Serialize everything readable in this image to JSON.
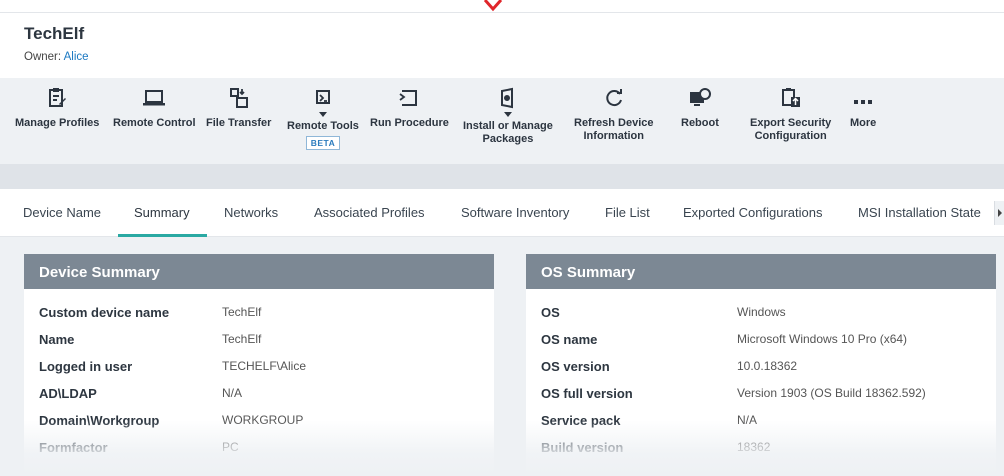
{
  "device": {
    "name": "TechElf",
    "owner_label": "Owner:",
    "owner_name": "Alice"
  },
  "toolbar": [
    {
      "label": "Manage Profiles",
      "icon": "manage-profiles-icon"
    },
    {
      "label": "Remote Control",
      "icon": "laptop-icon"
    },
    {
      "label": "File Transfer",
      "icon": "file-transfer-icon"
    },
    {
      "label": "Remote Tools",
      "icon": "remote-tools-icon",
      "badge": "BETA"
    },
    {
      "label": "Run Procedure",
      "icon": "run-procedure-icon"
    },
    {
      "label": "Install or Manage Packages",
      "line1": "Install or Manage",
      "line2": "Packages",
      "icon": "package-icon"
    },
    {
      "label": "Refresh Device Information",
      "line1": "Refresh Device",
      "line2": "Information",
      "icon": "refresh-icon"
    },
    {
      "label": "Reboot",
      "icon": "reboot-icon"
    },
    {
      "label": "Export Security Configuration",
      "line1": "Export Security",
      "line2": "Configuration",
      "icon": "export-icon"
    },
    {
      "label": "More",
      "icon": "more-icon"
    }
  ],
  "tabs": [
    "Device Name",
    "Summary",
    "Networks",
    "Associated Profiles",
    "Software Inventory",
    "File List",
    "Exported Configurations",
    "MSI Installation State"
  ],
  "active_tab": "Summary",
  "device_summary": {
    "title": "Device Summary",
    "rows": [
      {
        "key": "Custom device name",
        "value": "TechElf"
      },
      {
        "key": "Name",
        "value": "TechElf"
      },
      {
        "key": "Logged in user",
        "value": "TECHELF\\Alice"
      },
      {
        "key": "AD\\LDAP",
        "value": "N/A"
      },
      {
        "key": "Domain\\Workgroup",
        "value": "WORKGROUP"
      },
      {
        "key": "Formfactor",
        "value": "PC"
      }
    ]
  },
  "os_summary": {
    "title": "OS Summary",
    "rows": [
      {
        "key": "OS",
        "value": "Windows"
      },
      {
        "key": "OS name",
        "value": "Microsoft Windows 10 Pro (x64)"
      },
      {
        "key": "OS version",
        "value": "10.0.18362"
      },
      {
        "key": "OS full version",
        "value": "Version 1903 (OS Build 18362.592)"
      },
      {
        "key": "Service pack",
        "value": "N/A"
      },
      {
        "key": "Build version",
        "value": "18362"
      }
    ]
  },
  "colors": {
    "accent": "#2aa9a3",
    "panel_header": "#7c8894",
    "link": "#1a78c2",
    "alert_arrow": "#e0262b"
  }
}
